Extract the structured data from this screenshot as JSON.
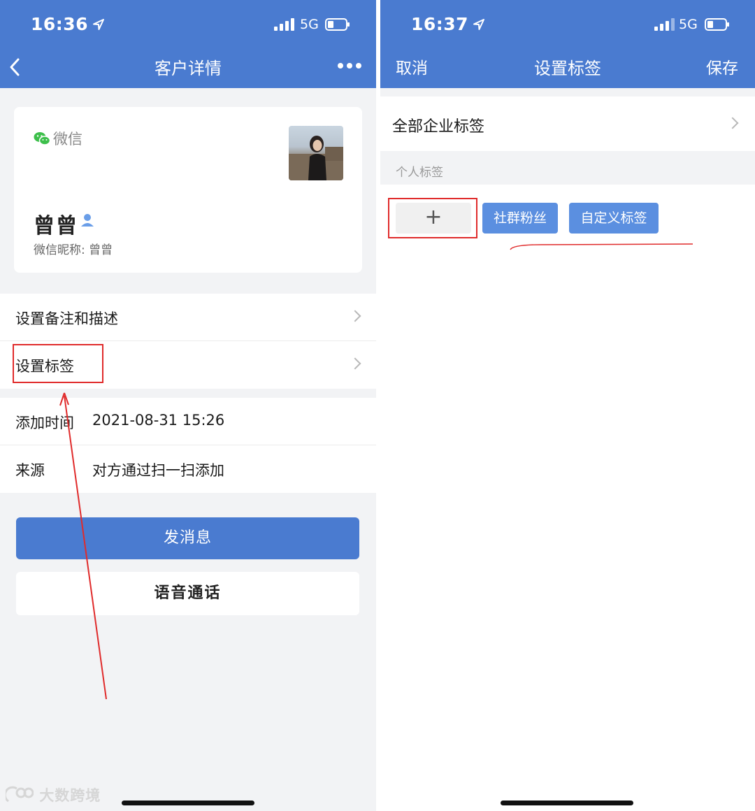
{
  "left_screen": {
    "status": {
      "time": "16:36",
      "network": "5G"
    },
    "nav": {
      "title": "客户详情"
    },
    "card": {
      "source_label": "微信",
      "name": "曾曾",
      "nickname": "微信昵称: 曾曾"
    },
    "menu": [
      {
        "label": "设置备注和描述"
      },
      {
        "label": "设置标签"
      }
    ],
    "info": [
      {
        "label": "添加时间",
        "value": "2021-08-31 15:26"
      },
      {
        "label": "来源",
        "value": "对方通过扫一扫添加"
      }
    ],
    "buttons": {
      "message": "发消息",
      "voice_call": "语音通话"
    }
  },
  "right_screen": {
    "status": {
      "time": "16:37",
      "network": "5G"
    },
    "nav": {
      "cancel": "取消",
      "title": "设置标签",
      "save": "保存"
    },
    "enterprise_tags_label": "全部企业标签",
    "personal_section_label": "个人标签",
    "tags": {
      "add_symbol": "+",
      "items": [
        "社群粉丝",
        "自定义标签"
      ]
    }
  },
  "watermark": "大数跨境",
  "colors": {
    "nav_blue": "#4a7bd0",
    "tag_blue": "#5b8fe0",
    "annotation_red": "#e02b2b",
    "background_gray": "#f2f3f5"
  }
}
